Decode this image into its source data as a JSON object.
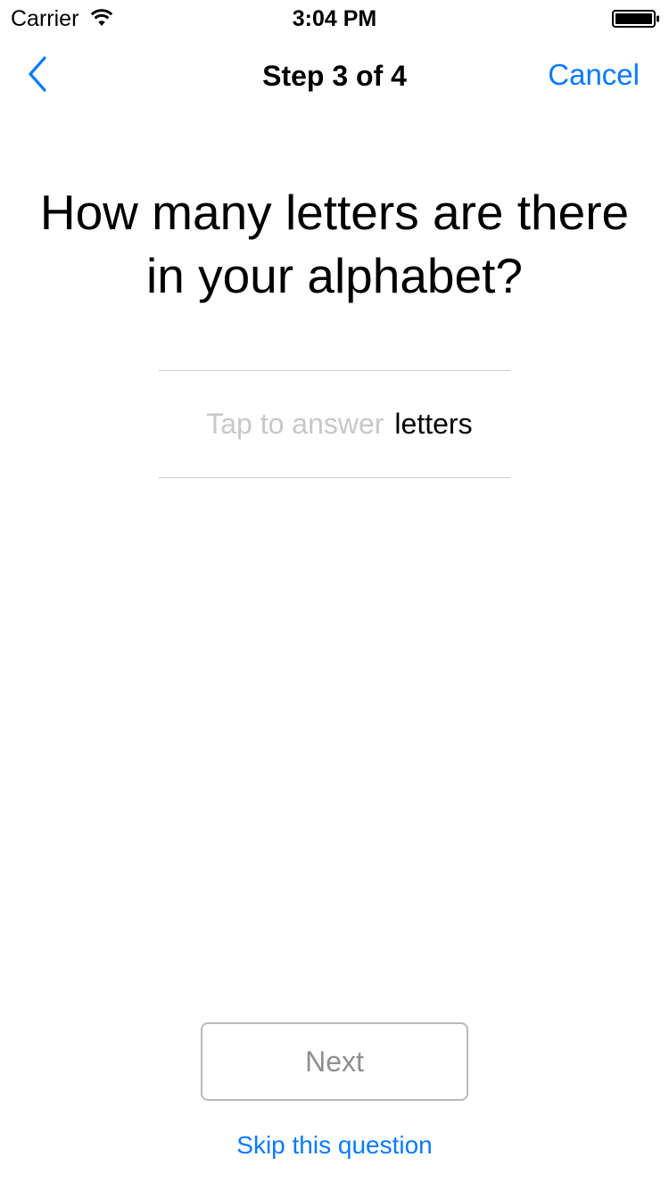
{
  "status_bar": {
    "carrier": "Carrier",
    "time": "3:04 PM",
    "icons": [
      "wifi-icon",
      "battery-icon"
    ]
  },
  "nav": {
    "back_icon": "chevron-left-icon",
    "title": "Step 3 of 4",
    "cancel_label": "Cancel"
  },
  "question": {
    "text": "How many letters are there in your alphabet?"
  },
  "answer": {
    "value": "",
    "placeholder": "Tap to answer",
    "unit": "letters"
  },
  "actions": {
    "next_label": "Next",
    "skip_label": "Skip this question"
  },
  "colors": {
    "accent": "#0a7aff",
    "placeholder": "#c7c7cc",
    "separator": "#cfcfd4",
    "disabled_text": "#8e8e93"
  }
}
